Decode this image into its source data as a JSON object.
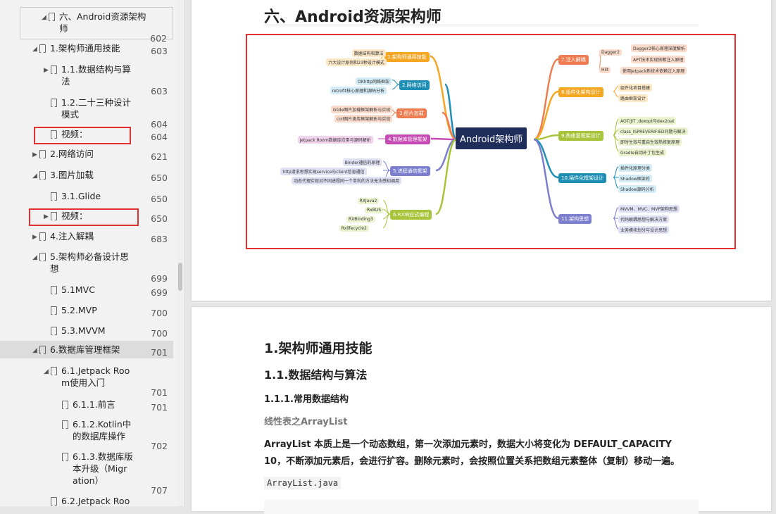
{
  "toc": [
    {
      "label": "六、Android资源架构\n师",
      "page": "602",
      "arrow": "down",
      "selected": false,
      "level": 0
    },
    {
      "label": "1.架构师通用技能",
      "page": "603",
      "arrow": "down",
      "level": 1
    },
    {
      "label": "1.1.数据结构与算\n法",
      "page": "603",
      "arrow": "right",
      "level": 2
    },
    {
      "label": "1.2.二十三种设计\n模式",
      "page": "604",
      "arrow": "",
      "level": 2
    },
    {
      "label": "视频：",
      "page": "604",
      "arrow": "",
      "level": 2
    },
    {
      "label": "2.网络访问",
      "page": "621",
      "arrow": "right",
      "level": 1
    },
    {
      "label": "3.图片加载",
      "page": "650",
      "arrow": "down",
      "level": 1
    },
    {
      "label": "3.1.Glide",
      "page": "650",
      "arrow": "",
      "level": 2
    },
    {
      "label": "视频：",
      "page": "650",
      "arrow": "right",
      "level": 2
    },
    {
      "label": "4.注入解耦",
      "page": "683",
      "arrow": "right",
      "level": 1
    },
    {
      "label": "5.架构师必备设计思\n想",
      "page": "699",
      "arrow": "down",
      "level": 1
    },
    {
      "label": "5.1MVC",
      "page": "699",
      "arrow": "",
      "level": 2
    },
    {
      "label": "5.2.MVP",
      "page": "700",
      "arrow": "",
      "level": 2
    },
    {
      "label": "5.3.MVVM",
      "page": "700",
      "arrow": "",
      "level": 2
    },
    {
      "label": "6.数据库管理框架",
      "page": "701",
      "arrow": "down",
      "level": 1
    },
    {
      "label": "6.1.Jetpack Roo\nm使用入门",
      "page": "701",
      "arrow": "down",
      "level": 2
    },
    {
      "label": "6.1.1.前言",
      "page": "701",
      "arrow": "",
      "level": 3
    },
    {
      "label": "6.1.2.Kotlin中\n的数据库操作",
      "page": "702",
      "arrow": "",
      "level": 3
    },
    {
      "label": "6.1.3.数据库版\n本升级（Migr\nation）",
      "page": "707",
      "arrow": "",
      "level": 3
    },
    {
      "label": "6.2.Jetpack Roo",
      "page": "",
      "arrow": "",
      "level": 2
    }
  ],
  "page1": {
    "heading": "六、Android资源架构师"
  },
  "mindmap": {
    "center": "Android架构师",
    "left": [
      {
        "title": "1.架构师通用技能",
        "color": "#f5a623",
        "leaves": [
          "数据结构和算法",
          "六大设计原则和23种设计模式"
        ],
        "leafColor": "#fde9c8"
      },
      {
        "title": "2.网络访问",
        "color": "#1f8fb5",
        "leaves": [
          "OKhttp网络框架",
          "retrofit核心原理和源码分析"
        ],
        "leafColor": "#d4ecf5"
      },
      {
        "title": "3.图片加载",
        "color": "#ef7d52",
        "leaves": [
          "Glide图片加载框架解析与实现",
          "coil图片类库框架解析与实现"
        ],
        "leafColor": "#fbdccc"
      },
      {
        "title": "4.数据库管理框架",
        "color": "#c54ab3",
        "leaves": [
          "Jetpack Room数据库应用与源码解析"
        ],
        "leafColor": "#f1d3ec"
      },
      {
        "title": "5.进程通信框架",
        "color": "#7b7fce",
        "leaves": [
          "Binder通信的原理",
          "http请求思想实现service与client信息通信",
          "动态代理实现对不同进程同一个单利的方法无法感知调用"
        ],
        "leafColor": "#e0e1f5"
      },
      {
        "title": "6.RX响应式编程",
        "color": "#a8c43a",
        "leaves": [
          "RXJava2",
          "RxBUS",
          "RXBinding3",
          "Rxlifecycle2"
        ],
        "leafColor": "#ecf3cf"
      }
    ],
    "right": [
      {
        "title": "7.注入解耦",
        "color": "#ef7d52",
        "sub": [
          "Dagger2",
          "Hilt"
        ],
        "leaves": [
          "Dagger2核心原理深度解析",
          "APT技术实现依赖注入原理",
          "使用Jetpack新技术依赖注入原理"
        ],
        "leafColor": "#fbdccc"
      },
      {
        "title": "8.组件化架构设计",
        "color": "#f5a623",
        "leaves": [
          "组件化项目搭建",
          "路由框架设计"
        ],
        "leafColor": "#fde9c8"
      },
      {
        "title": "9.热修复框架设计",
        "color": "#a8c43a",
        "leaves": [
          "AOT/JIT .dexopt与dex2oat",
          "class_ISPREVERIFIED问题与解决",
          "即时生效与重启生效热修复原理",
          "Gradle自动补丁包生成"
        ],
        "leafColor": "#ecf3cf"
      },
      {
        "title": "10.插件化框架设计",
        "color": "#1f8fb5",
        "leaves": [
          "插件化原理分类",
          "Shadow框架的",
          "Shadow源码分析"
        ],
        "leafColor": "#d4ecf5"
      },
      {
        "title": "11.架构思想",
        "color": "#7b7fce",
        "leaves": [
          "MVVM、MVC、MVP架构思想",
          "代码解耦思想与解决方案",
          "业务模块划分与设计思想"
        ],
        "leafColor": "#e0e1f5"
      }
    ]
  },
  "page2": {
    "h1": "1.架构师通用技能",
    "h2": "1.1.数据结构与算法",
    "h3": "1.1.1.常用数据结构",
    "h4": "线性表之ArrayList",
    "para": "ArrayList 本质上是一个动态数组，第一次添加元素时，数据大小将变化为 DEFAULT_CAPACITY 10，不断添加元素后，会进行扩容。删除元素时，会按照位置关系把数组元素整体（复制）移动一遍。",
    "code": "ArrayList.java"
  },
  "colors": {
    "accent": "#e03030",
    "sidebar_bg": "#f2f2f2"
  }
}
